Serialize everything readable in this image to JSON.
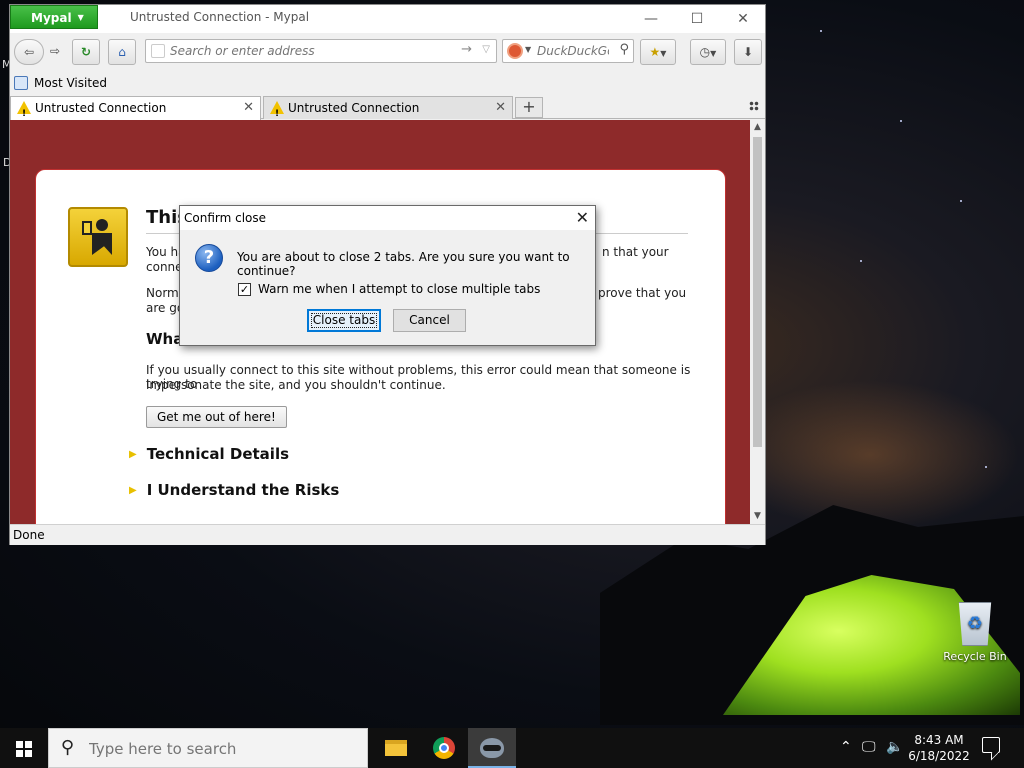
{
  "browser": {
    "app_button": "Mypal",
    "window_title": "Untrusted Connection - Mypal",
    "url_placeholder": "Search or enter address",
    "search_placeholder": "DuckDuckGo",
    "bookmarks_toolbar": {
      "most_visited": "Most Visited"
    },
    "tabs": [
      {
        "label": "Untrusted Connection",
        "active": true
      },
      {
        "label": "Untrusted Connection",
        "active": false
      }
    ],
    "status": "Done"
  },
  "error_page": {
    "title_visible": "This",
    "para1_left": "You ha",
    "para1_left2": "conne",
    "para1_right": "n that your",
    "para2_left": "Norma",
    "para2_left2": "are go",
    "para2_right": "prove that you",
    "heading_visible": "Wha",
    "para3_line1": "If you usually connect to this site without problems, this error could mean that someone is trying to",
    "para3_line2": "impersonate the site, and you shouldn't continue.",
    "get_out_button": "Get me out of here!",
    "technical_details": "Technical Details",
    "understand_risks": "I Understand the Risks"
  },
  "dialog": {
    "title": "Confirm close",
    "message": "You are about to close 2 tabs. Are you sure you want to continue?",
    "checkbox_label": "Warn me when I attempt to close multiple tabs",
    "checkbox_checked": true,
    "close_tabs_button": "Close tabs",
    "cancel_button": "Cancel"
  },
  "desktop": {
    "recycle_bin_label": "Recycle Bin",
    "edge_letters": [
      "M",
      "D"
    ]
  },
  "taskbar": {
    "search_placeholder": "Type here to search",
    "pinned": [
      "file-explorer-icon",
      "chrome-icon",
      "mypal-icon"
    ],
    "time": "8:43 AM",
    "date": "6/18/2022"
  }
}
